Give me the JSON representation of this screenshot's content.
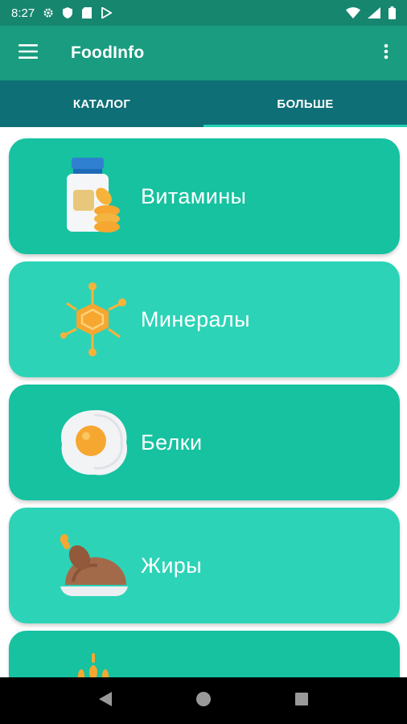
{
  "status_bar": {
    "time": "8:27",
    "icons_left": [
      "settings-icon",
      "shield-icon",
      "sd-card-icon",
      "play-store-icon"
    ],
    "icons_right": [
      "wifi-icon",
      "signal-icon",
      "battery-icon"
    ]
  },
  "app_bar": {
    "title": "FoodInfo",
    "menu_icon": "hamburger-menu-icon",
    "overflow_icon": "more-vert-icon",
    "color": "#199c7f"
  },
  "tabs": [
    {
      "label": "КАТАЛОГ"
    },
    {
      "label": "БОЛЬШЕ"
    }
  ],
  "tab_bar_color": "#0f6f76",
  "categories": [
    {
      "label": "Витамины",
      "icon": "vitamin-jar-icon",
      "color": "#16c2a0"
    },
    {
      "label": "Минералы",
      "icon": "molecule-icon",
      "color": "#2dd3b7"
    },
    {
      "label": "Белки",
      "icon": "fried-egg-icon",
      "color": "#16c2a0"
    },
    {
      "label": "Жиры",
      "icon": "roast-chicken-icon",
      "color": "#2dd3b7"
    },
    {
      "label": "",
      "icon": "wheat-icon",
      "color": "#16c2a0"
    }
  ],
  "nav_bar": {
    "back_icon": "back-triangle-icon",
    "home_icon": "home-circle-icon",
    "recents_icon": "recents-square-icon"
  }
}
